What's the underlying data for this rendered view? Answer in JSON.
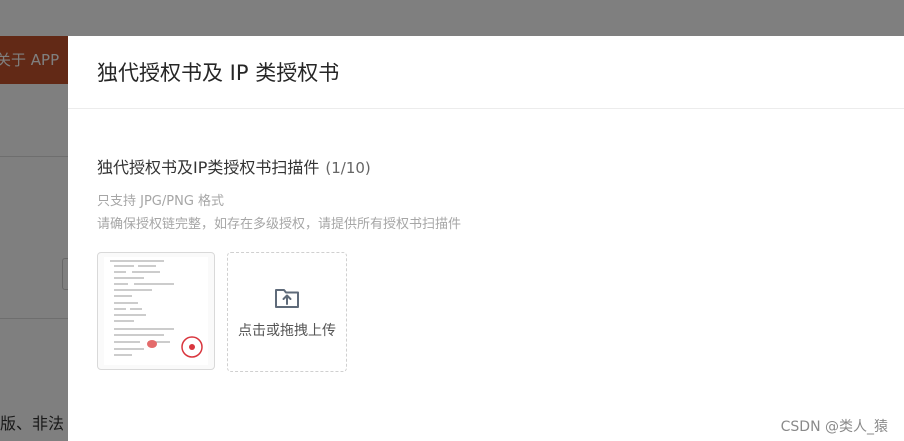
{
  "background": {
    "banner_text": "关于 APP",
    "bottom_text": "版、非法"
  },
  "drawer": {
    "title": "独代授权书及 IP 类授权书",
    "section_title": "独代授权书及IP类授权书扫描件",
    "section_count": "(1/10)",
    "hint_format": "只支持 JPG/PNG 格式",
    "hint_completeness": "请确保授权链完整，如存在多级授权，请提供所有授权书扫描件",
    "upload_label": "点击或拖拽上传",
    "thumbnail_icon": "document-scan-thumbnail",
    "upload_icon": "folder-upload-icon"
  },
  "watermark": "CSDN @类人_猿",
  "colors": {
    "banner": "#c4532c",
    "overlay": "rgba(0,0,0,0.5)",
    "stamp": "#d9363e"
  }
}
